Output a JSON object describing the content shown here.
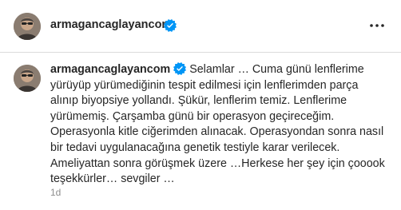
{
  "post_header": {
    "username": "armagancaglayancom",
    "verified_icon": "verified-badge-icon",
    "more_icon": "more-options-icon",
    "avatar_icon": "profile-avatar"
  },
  "caption": {
    "username": "armagancaglayancom",
    "text": "Selamlar … Cuma günü lenflerime yürüyüp yürümediğinin tespit edilmesi için lenflerimden parça alınıp biyopsiye yollandı. Şükür, lenflerim temiz. Lenflerime yürümemiş. Çarşamba günü bir operasyon geçireceğim. Operasyonla kitle ciğerimden alınacak. Operasyondan sonra nasıl bir tedavi uygulanacağına genetik testiyle karar verilecek. Ameliyattan sonra görüşmek üzere …Herkese her şey için çooook teşekkürler… sevgiler …",
    "timestamp": "1d"
  },
  "colors": {
    "verified_blue": "#0095f6",
    "text": "#262626",
    "muted": "#8e8e8e",
    "divider": "#dbdbdb"
  }
}
